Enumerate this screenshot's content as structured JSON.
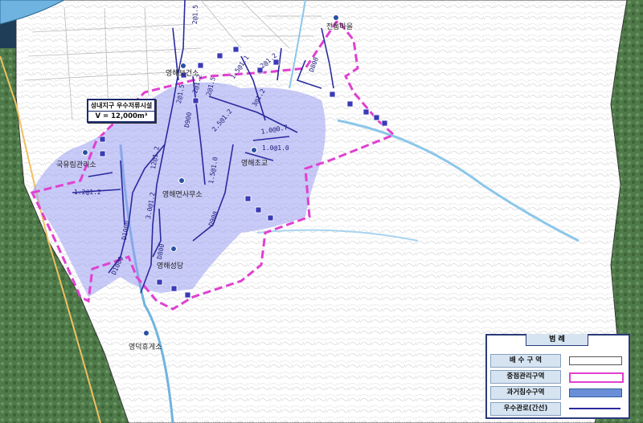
{
  "map": {
    "callout": {
      "title": "성내지구 우수저류시설",
      "volume": "V = 12,000m³"
    },
    "places": [
      {
        "name": "영해보건소"
      },
      {
        "name": "전통마을"
      },
      {
        "name": "국유림관리소"
      },
      {
        "name": "영해초교"
      },
      {
        "name": "영해면사무소"
      },
      {
        "name": "영해성당"
      },
      {
        "name": "영덕휴게소"
      }
    ],
    "pipe_labels": [
      "2@1.5",
      "2@1.5",
      "2@1.2",
      "1.5@1.1",
      "2@1.2",
      "2@1.5",
      "2.5@1.2",
      "3@1.2",
      "1.0@0.7",
      "1.0@1.0",
      "12@1.2",
      "1.5@1.0",
      "1.2@1.2",
      "D900",
      "D1000",
      "D1000",
      "D800",
      "D900",
      "3.0@1.2",
      "D800"
    ],
    "colors": {
      "drainage_area": "#ffffff",
      "focus_area": "#e040d0",
      "flooded_area": "#9a9ef0",
      "main_pipe": "#2a2aa0",
      "river": "#6fb4e0"
    },
    "legend": {
      "title": "범 례",
      "items": [
        {
          "label": "배 수 구 역",
          "symbol": "drainage-area"
        },
        {
          "label": "중점관리구역",
          "symbol": "focus-area"
        },
        {
          "label": "과거침수구역",
          "symbol": "flooded-area"
        },
        {
          "label": "우수관로(간선)",
          "symbol": "main-pipe"
        }
      ]
    }
  }
}
